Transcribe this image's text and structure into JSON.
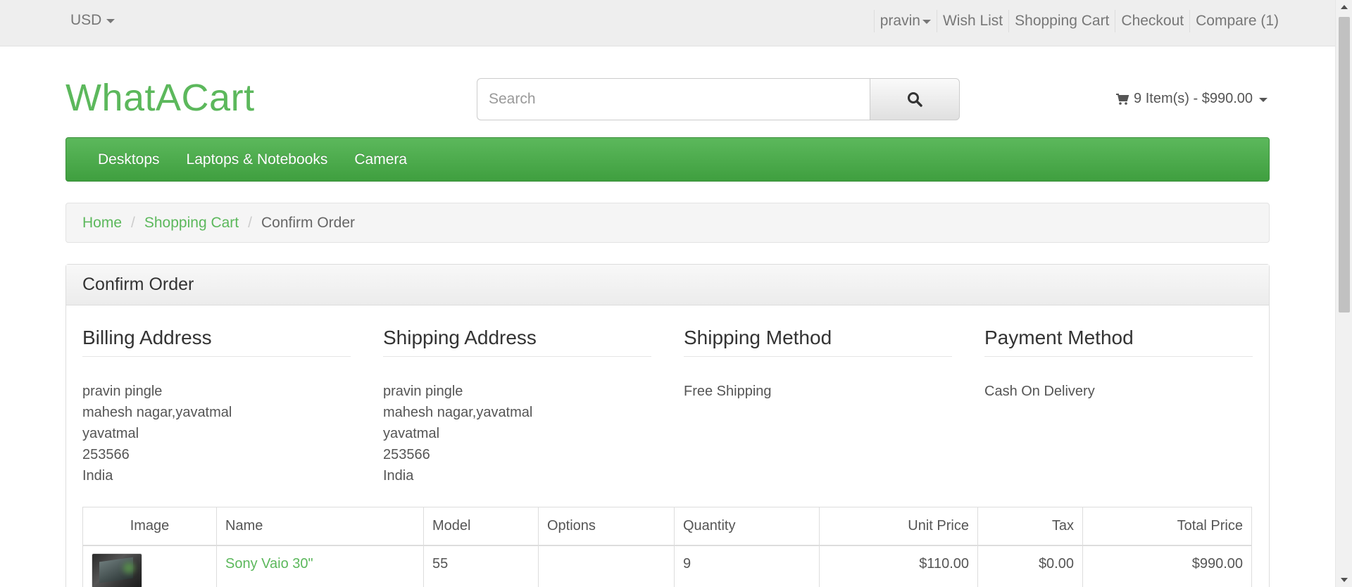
{
  "topbar": {
    "currency": "USD",
    "links": [
      "pravin",
      "Wish List",
      "Shopping Cart",
      "Checkout",
      "Compare (1)"
    ]
  },
  "header": {
    "logo": "WhatACart",
    "search_placeholder": "Search",
    "search_icon": "search-icon",
    "cart_icon": "cart-icon",
    "cart_total": "9 Item(s) - $990.00"
  },
  "menu": [
    "Desktops",
    "Laptops & Notebooks",
    "Camera"
  ],
  "breadcrumb": {
    "home": "Home",
    "cart": "Shopping Cart",
    "current": "Confirm Order"
  },
  "panel": {
    "title": "Confirm Order",
    "billing": {
      "title": "Billing Address",
      "lines": [
        "pravin pingle",
        "mahesh nagar,yavatmal",
        "yavatmal",
        "253566",
        "India"
      ]
    },
    "shipping": {
      "title": "Shipping Address",
      "lines": [
        "pravin pingle",
        "mahesh nagar,yavatmal",
        "yavatmal",
        "253566",
        "India"
      ]
    },
    "shipping_method": {
      "title": "Shipping Method",
      "value": "Free Shipping"
    },
    "payment_method": {
      "title": "Payment Method",
      "value": "Cash On Delivery"
    }
  },
  "table": {
    "headers": [
      "Image",
      "Name",
      "Model",
      "Options",
      "Quantity",
      "Unit Price",
      "Tax",
      "Total Price"
    ],
    "rows": [
      {
        "name": "Sony Vaio 30\"",
        "model": "55",
        "options": "",
        "quantity": "9",
        "unit_price": "$110.00",
        "tax": "$0.00",
        "total": "$990.00"
      }
    ]
  },
  "colors": {
    "brand_green": "#5cb85c",
    "nav_green_dark": "#3f9f3f"
  }
}
